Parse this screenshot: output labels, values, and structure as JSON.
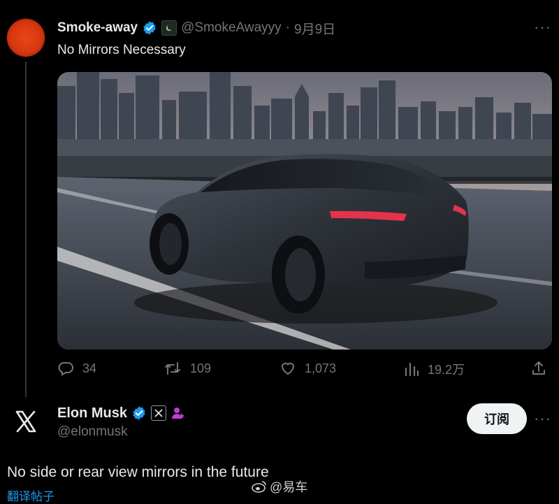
{
  "tweet1": {
    "display_name": "Smoke-away",
    "handle": "@SmokeAwayyy",
    "separator": "·",
    "date": "9月9日",
    "more": "···",
    "text": "No Mirrors Necessary",
    "media_alt": "Dark electric SUV without side mirrors driving on a bridge with city skyline",
    "actions": {
      "replies": "34",
      "reposts": "109",
      "likes": "1,073",
      "views": "19.2万"
    }
  },
  "tweet2": {
    "display_name": "Elon Musk",
    "handle": "@elonmusk",
    "subscribe_label": "订阅",
    "more": "···",
    "text": "No side or rear view mirrors in the future",
    "translate_label": "翻译帖子"
  },
  "watermark": {
    "text": "@易车"
  },
  "colors": {
    "background": "#000000",
    "text": "#e7e9ea",
    "secondary": "#71767b",
    "verified": "#1d9bf0",
    "link": "#1d9bf0",
    "subscribe_bg": "#eff3f4"
  },
  "icons": [
    "verified-badge-icon",
    "affiliate-badge-icon",
    "more-icon",
    "reply-icon",
    "repost-icon",
    "like-icon",
    "views-icon",
    "share-icon",
    "x-logo-icon",
    "x-affiliate-badge-icon",
    "subscriber-badge-icon",
    "weibo-icon"
  ]
}
